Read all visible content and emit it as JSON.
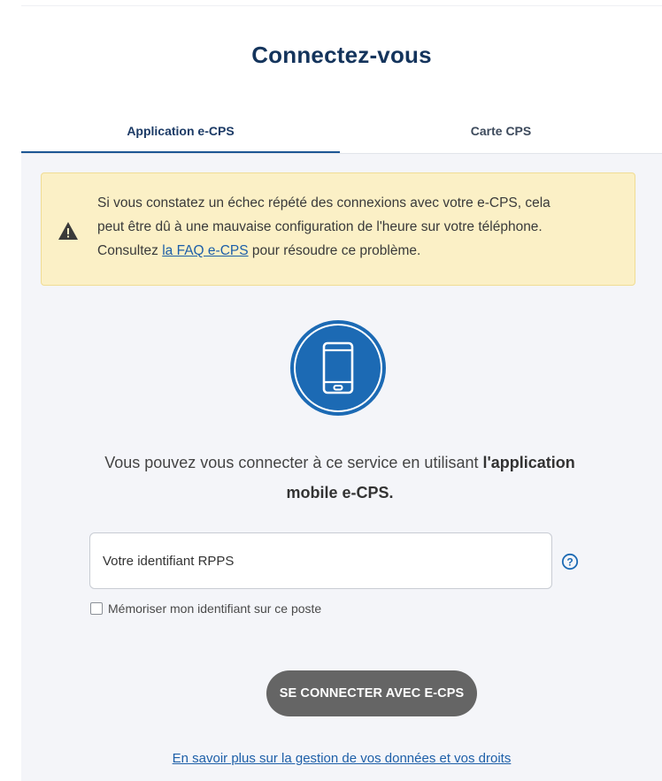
{
  "header": {
    "title": "Connectez-vous"
  },
  "tabs": [
    {
      "label": "Application e-CPS",
      "active": true
    },
    {
      "label": "Carte CPS",
      "active": false
    }
  ],
  "alert": {
    "line1": "Si vous constatez un échec répété des connexions avec votre e-CPS, cela",
    "line2": "peut être dû à une mauvaise configuration de l'heure sur votre téléphone.",
    "line3_prefix": "Consultez ",
    "link_text": "la FAQ e-CPS",
    "line3_suffix": " pour résoudre ce problème.",
    "icon": "warning-triangle-icon"
  },
  "intro": {
    "text_prefix": "Vous pouvez vous connecter à ce service en utilisant ",
    "bold_line1": "l'application",
    "bold_line2": "mobile e-CPS."
  },
  "form": {
    "id_placeholder": "Votre identifiant RPPS",
    "id_value": "",
    "remember_label": "Mémoriser mon identifiant sur ce poste",
    "remember_checked": false,
    "connect_label": "SE CONNECTER AVEC E-CPS"
  },
  "footer": {
    "link": "En savoir plus sur la gestion de vos données et vos droits"
  },
  "colors": {
    "title": "#14345c",
    "accent": "#1c6ab4",
    "alert_bg": "#fbf0c6",
    "button_bg": "#656565",
    "link": "#1d5fa8"
  }
}
